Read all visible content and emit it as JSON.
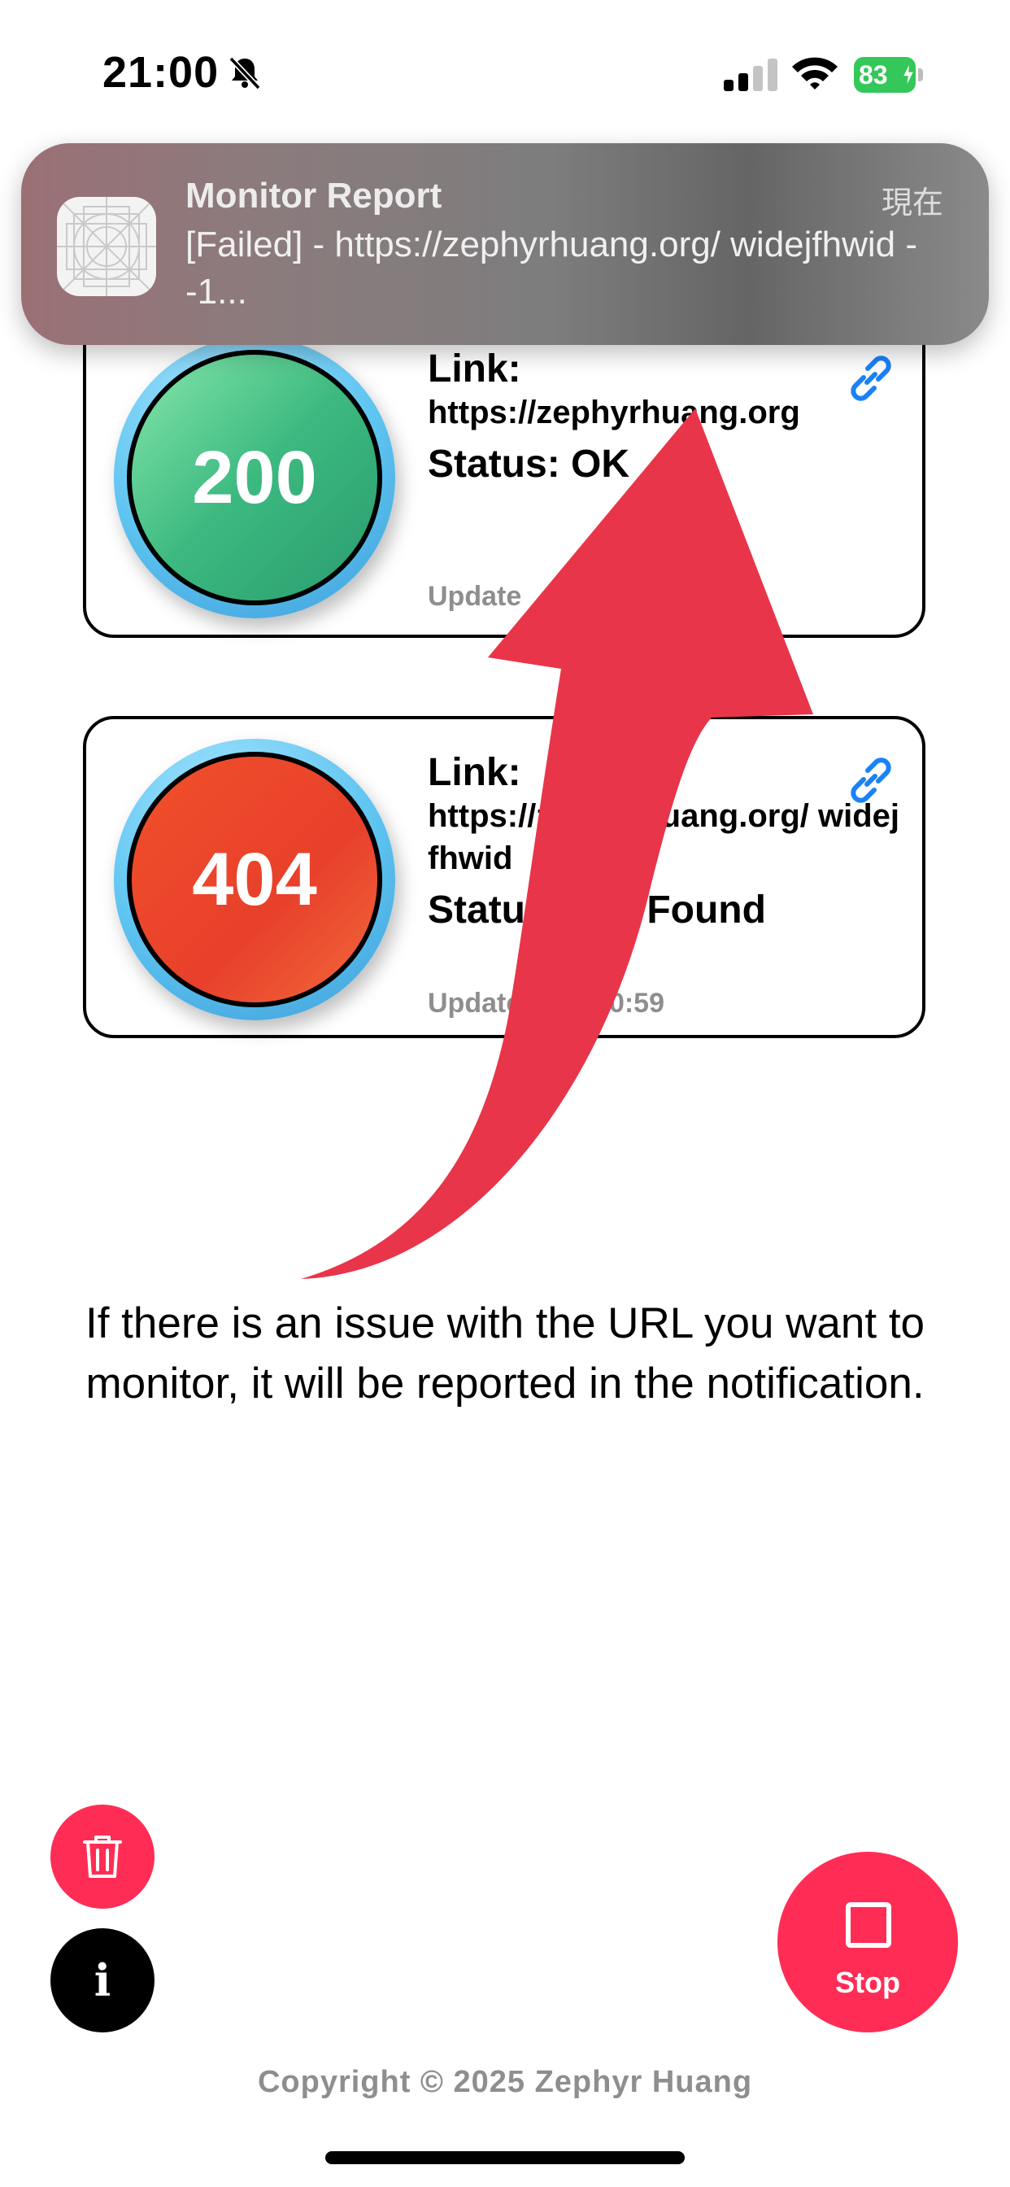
{
  "status_bar": {
    "time": "21:00",
    "battery": "83"
  },
  "notification": {
    "title": "Monitor Report",
    "body": "[Failed] - https://zephyrhuang.org/ widejfhwid - -1...",
    "time": "現在"
  },
  "cards": [
    {
      "code": "200",
      "link_label": "Link:",
      "url": "https://zephyrhuang.org",
      "status": "Status: OK",
      "updated": "Update"
    },
    {
      "code": "404",
      "link_label": "Link:",
      "url": "https://zephyrhuang.org/ widejfhwid",
      "status": "Status: Not Found",
      "updated": "Updated: 21 20:59"
    }
  ],
  "caption": "If there is an issue with the URL you want to monitor, it will be reported in the notification.",
  "buttons": {
    "stop_label": "Stop",
    "info_label": "i"
  },
  "copyright": "Copyright © 2025 Zephyr Huang",
  "colors": {
    "accent": "#ff2d55",
    "arrow": "#e8354a",
    "ok": "#3cb980",
    "error": "#e8402b"
  }
}
